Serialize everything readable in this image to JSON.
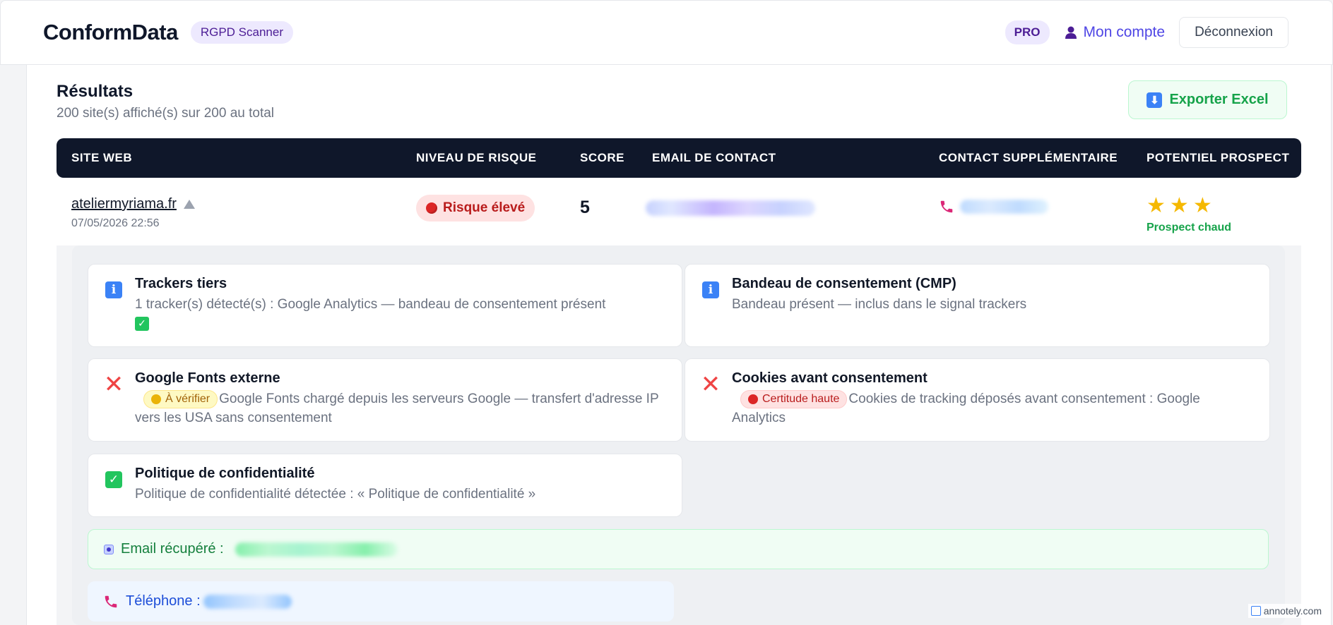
{
  "header": {
    "logo": "ConformData",
    "logo_badge": "RGPD Scanner",
    "plan_badge": "PRO",
    "account_label": "Mon compte",
    "logout_label": "Déconnexion"
  },
  "results": {
    "title": "Résultats",
    "subtitle": "200 site(s) affiché(s) sur 200 au total",
    "export_label": "Exporter Excel",
    "columns": [
      "SITE WEB",
      "NIVEAU DE RISQUE",
      "SCORE",
      "EMAIL DE CONTACT",
      "CONTACT SUPPLÉMENTAIRE",
      "POTENTIEL PROSPECT"
    ]
  },
  "row": {
    "site": "ateliermyriama.fr",
    "date": "07/05/2026 22:56",
    "risk": "Risque élevé",
    "score": "5",
    "stars": 3,
    "prospect": "Prospect chaud"
  },
  "checks": [
    {
      "status": "info",
      "title": "Trackers tiers",
      "desc": "1 tracker(s) détecté(s) : Google Analytics — bandeau de consentement présent",
      "tag": ""
    },
    {
      "status": "info",
      "title": "Bandeau de consentement (CMP)",
      "desc": "Bandeau présent — inclus dans le signal trackers",
      "tag": ""
    },
    {
      "status": "fail",
      "title": "Google Fonts externe",
      "tag": "À vérifier",
      "desc": "Google Fonts chargé depuis les serveurs Google — transfert d'adresse IP vers les USA sans consentement"
    },
    {
      "status": "fail",
      "title": "Cookies avant consentement",
      "tag": "Certitude haute",
      "desc": "Cookies de tracking déposés avant consentement : Google Analytics"
    },
    {
      "status": "ok",
      "title": "Politique de confidentialité",
      "desc": "Politique de confidentialité détectée : « Politique de confidentialité »",
      "tag": ""
    }
  ],
  "email_box": {
    "label": "Email récupéré :"
  },
  "phone_box": {
    "label": "Téléphone :"
  },
  "watermark": "annotely.com",
  "colors": {
    "brand": "#4f46e5",
    "header_dark": "#0f172a",
    "success": "#16a34a",
    "danger": "#dc2626",
    "warning": "#eab308"
  }
}
